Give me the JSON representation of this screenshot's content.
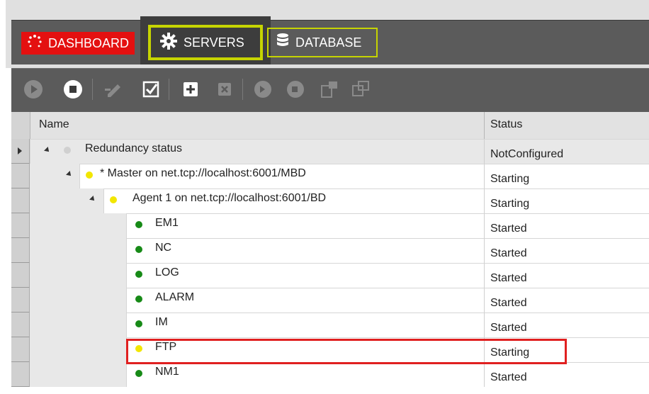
{
  "tabs": {
    "dashboard": {
      "label": "DASHBOARD",
      "icon": "spinner-icon",
      "color": "#e41010"
    },
    "servers": {
      "label": "SERVERS",
      "icon": "gear-icon",
      "active": true,
      "accent": "#c6d400"
    },
    "database": {
      "label": "DATABASE",
      "icon": "database-icon"
    }
  },
  "toolbar": {
    "icons": [
      "play-icon",
      "stop-icon",
      "edit-icon",
      "checkbox-icon",
      "add-icon",
      "remove-icon",
      "play-r-icon",
      "stop-r-icon",
      "export-icon",
      "window-icon"
    ]
  },
  "grid": {
    "columns": {
      "name": "Name",
      "status": "Status"
    },
    "rows": [
      {
        "name": "Redundancy status",
        "status": "NotConfigured",
        "dot": "#d0d0d0"
      },
      {
        "name": "* Master on net.tcp://localhost:6001/MBD",
        "status": "Starting",
        "dot": "#f2e600"
      },
      {
        "name": "Agent 1 on net.tcp://localhost:6001/BD",
        "status": "Starting",
        "dot": "#f2e600"
      },
      {
        "name": "EM1",
        "status": "Started",
        "dot": "#178a17"
      },
      {
        "name": "NC",
        "status": "Started",
        "dot": "#178a17"
      },
      {
        "name": "LOG",
        "status": "Started",
        "dot": "#178a17"
      },
      {
        "name": "ALARM",
        "status": "Started",
        "dot": "#178a17"
      },
      {
        "name": "IM",
        "status": "Started",
        "dot": "#178a17"
      },
      {
        "name": "FTP",
        "status": "Starting",
        "dot": "#f2e600"
      },
      {
        "name": "NM1",
        "status": "Started",
        "dot": "#178a17"
      }
    ]
  }
}
